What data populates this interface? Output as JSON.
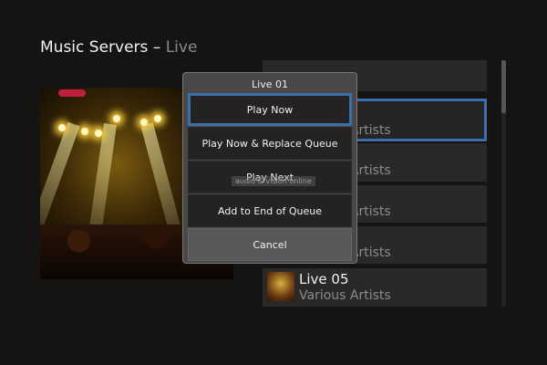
{
  "header": {
    "title": "Music Servers",
    "separator": " – ",
    "subtitle": "Live"
  },
  "list": {
    "items": [
      {
        "artist": ""
      },
      {
        "artist": "Various Artists",
        "selected": true
      },
      {
        "artist": "Various Artists"
      },
      {
        "artist": "Various Artists"
      },
      {
        "artist": "Various Artists"
      },
      {
        "name": "Live 05",
        "artist": "Various Artists"
      }
    ]
  },
  "dialog": {
    "title": "Live 01",
    "options": [
      "Play Now",
      "Play Now & Replace Queue",
      "Play Next",
      "Add to End of Queue"
    ],
    "cancel": "Cancel"
  },
  "watermark": "audio & vision online",
  "colors": {
    "accent": "#3a6fae"
  }
}
